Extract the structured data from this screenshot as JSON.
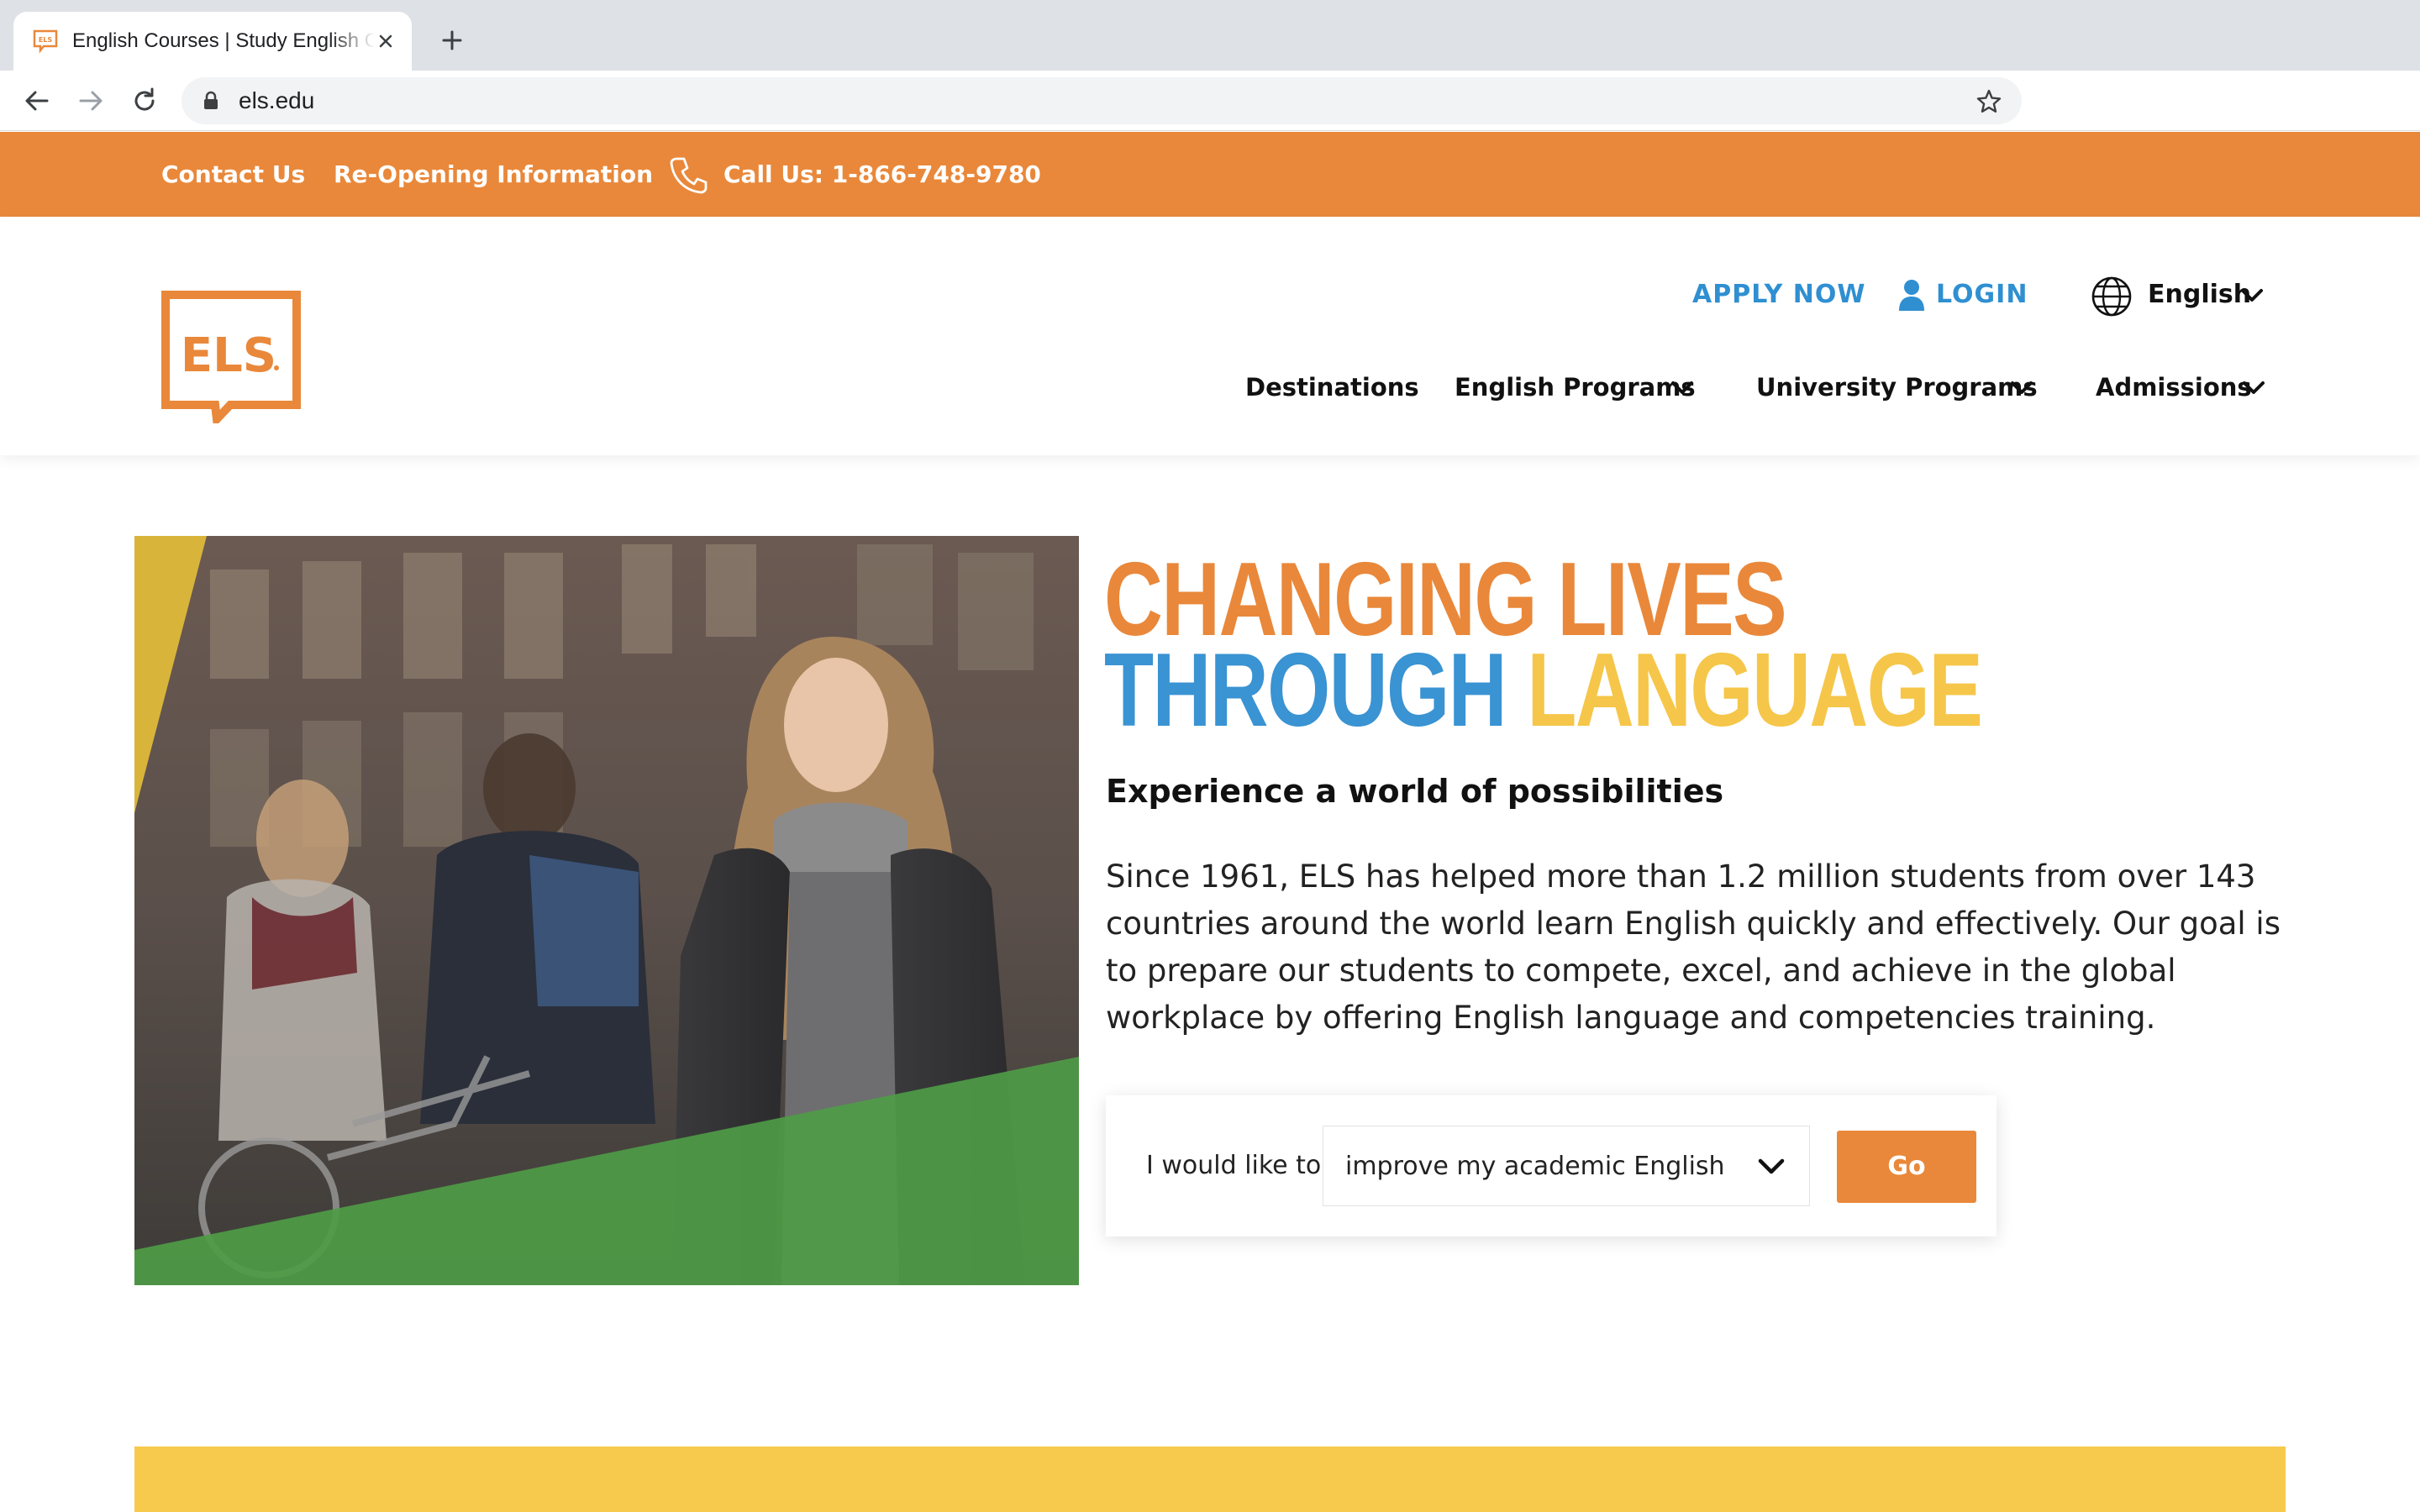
{
  "browser": {
    "tab_title": "English Courses | Study English Online & In Person",
    "url": "els.edu"
  },
  "utility_bar": {
    "contact": "Contact Us",
    "reopening": "Re-Opening Information",
    "call": "Call Us: 1-866-748-9780"
  },
  "header": {
    "logo_text": "ELS",
    "apply": "APPLY NOW",
    "login": "LOGIN",
    "language": "English",
    "nav": {
      "destinations": "Destinations",
      "english_programs": "English Programs",
      "university_programs": "University Programs",
      "admissions": "Admissions"
    }
  },
  "hero": {
    "headline_line1": "CHANGING LIVES",
    "headline_line2_a": "THROUGH",
    "headline_line2_b": "LANGUAGE",
    "subheading": "Experience a world of possibilities",
    "paragraph": "Since 1961, ELS has helped more than 1.2 million students from over 143 countries around the world learn English quickly and effectively. Our goal is to prepare our students to compete, excel, and achieve in the global workplace by offering English language and competencies training."
  },
  "finder": {
    "label": "I would like to",
    "selected": "improve my academic English",
    "button": "Go"
  },
  "colors": {
    "orange": "#e9883a",
    "blue": "#3a93d2",
    "yellow": "#f5c649",
    "green": "#4e9b47"
  }
}
